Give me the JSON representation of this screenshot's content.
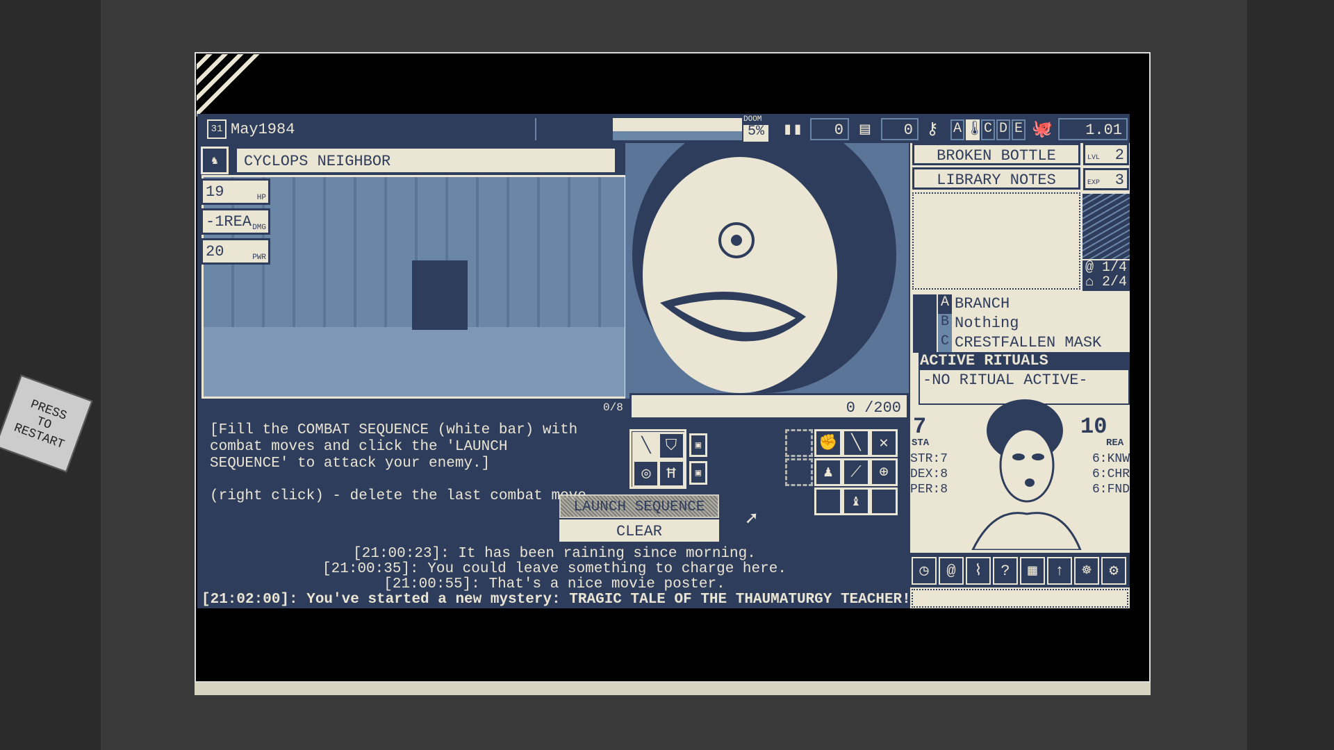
{
  "sticker": "PRESS TO RESTART",
  "topbar": {
    "date_day": "31",
    "date": "May1984",
    "doom_label": "DOOM",
    "doom_value": "5%",
    "counter1": "0",
    "counter2": "0",
    "keys": [
      "A",
      "B",
      "C",
      "D",
      "E"
    ],
    "version_value": "1.01"
  },
  "enemy": {
    "name": "CYCLOPS NEIGHBOR",
    "hp": "19",
    "hp_label": "HP",
    "dmg": "-1REA",
    "dmg_label": "DMG",
    "pwr": "20",
    "pwr_label": "PWR"
  },
  "combat": {
    "slots": "0/8",
    "sequence": "0 /200",
    "instructions": [
      "[Fill the COMBAT SEQUENCE (white bar) with",
      "combat moves and click the 'LAUNCH",
      "SEQUENCE' to attack your enemy.]"
    ],
    "hint": "(right click) - delete the last combat move",
    "launch_label": "LAUNCH SEQUENCE",
    "clear_label": "CLEAR"
  },
  "log": [
    "[21:00:23]: It has been raining since morning.",
    "[21:00:35]: You could leave something to charge here.",
    "[21:00:55]: That's a nice movie poster.",
    "[21:02:00]: You've started a new mystery: TRAGIC TALE OF THE THAUMATURGY TEACHER!"
  ],
  "side": {
    "items": [
      "BROKEN BOTTLE",
      "LIBRARY NOTES"
    ],
    "lvl_label": "LVL",
    "lvl": "2",
    "exp_label": "EXP",
    "exp": "3",
    "spells": "1/4",
    "slots": "2/4",
    "equipment": [
      {
        "key": "A",
        "name": "BRANCH"
      },
      {
        "key": "B",
        "name": "Nothing"
      },
      {
        "key": "C",
        "name": "CRESTFALLEN MASK"
      }
    ],
    "rituals_title": "ACTIVE RITUALS",
    "rituals_value": "-NO RITUAL ACTIVE-"
  },
  "character": {
    "sta": "7",
    "sta_label": "STA",
    "rea": "10",
    "rea_label": "REA",
    "str": "STR:7",
    "dex": "DEX:8",
    "per": "PER:8",
    "knw": "6:KNW",
    "chr": "6:CHR",
    "fnd": "6:FND"
  },
  "colors": {
    "navy": "#2f3d5c",
    "cream": "#ebe5d3",
    "mid": "#6b87a8"
  }
}
